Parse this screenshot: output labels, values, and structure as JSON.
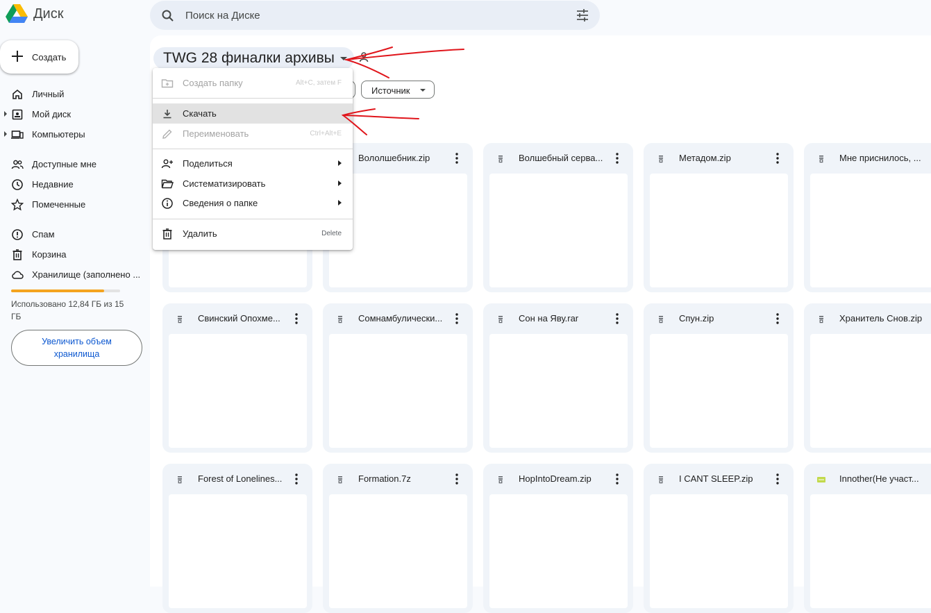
{
  "app": {
    "logo_text": "Диск"
  },
  "search": {
    "placeholder": "Поиск на Диске"
  },
  "sidebar": {
    "create_label": "Создать",
    "items": [
      {
        "label": "Личный",
        "icon": "home-icon"
      },
      {
        "label": "Мой диск",
        "icon": "my-drive-icon"
      },
      {
        "label": "Компьютеры",
        "icon": "computers-icon"
      },
      {
        "label": "Доступные мне",
        "icon": "shared-icon"
      },
      {
        "label": "Недавние",
        "icon": "clock-icon"
      },
      {
        "label": "Помеченные",
        "icon": "star-icon"
      },
      {
        "label": "Спам",
        "icon": "spam-icon"
      },
      {
        "label": "Корзина",
        "icon": "trash-icon"
      },
      {
        "label": "Хранилище (заполнено ...",
        "icon": "cloud-icon"
      }
    ],
    "storage": {
      "used_fraction": 0.856,
      "text": "Использовано 12,84 ГБ из 15 ГБ"
    },
    "upgrade_label": "Увеличить объем хранилища"
  },
  "main": {
    "folder_title": "TWG 28 финалки архивы",
    "filters": {
      "source": "Источник"
    }
  },
  "menu": {
    "items": [
      {
        "label": "Создать папку",
        "shortcut": "Alt+C, затем F",
        "disabled": true
      },
      {
        "label": "Скачать",
        "shortcut": "",
        "highlighted": true
      },
      {
        "label": "Переименовать",
        "shortcut": "Ctrl+Alt+E",
        "disabled": true
      },
      {
        "label": "Поделиться",
        "submenu": true
      },
      {
        "label": "Систематизировать",
        "submenu": true
      },
      {
        "label": "Сведения о папке",
        "submenu": true
      },
      {
        "label": "Удалить",
        "shortcut": "Delete"
      }
    ]
  },
  "files": [
    {
      "name": "Вололшебник.zip",
      "type": "archive"
    },
    {
      "name": "Волшебный серва...",
      "type": "archive"
    },
    {
      "name": "Метадом.zip",
      "type": "archive"
    },
    {
      "name": "Мне приснилось, ...",
      "type": "archive"
    },
    {
      "name": "Свинский Опохме...",
      "type": "archive"
    },
    {
      "name": "Сомнамбулически...",
      "type": "archive"
    },
    {
      "name": "Сон на Яву.rar",
      "type": "archive"
    },
    {
      "name": "Спун.zip",
      "type": "archive"
    },
    {
      "name": "Хранитель Снов.zip",
      "type": "archive"
    },
    {
      "name": "Forest of Lonelines...",
      "type": "archive"
    },
    {
      "name": "Formation.7z",
      "type": "archive"
    },
    {
      "name": "HopIntoDream.zip",
      "type": "archive"
    },
    {
      "name": "I CANT SLEEP.zip",
      "type": "archive"
    },
    {
      "name": "Innother(Не участ...",
      "type": "sheet"
    }
  ],
  "colors": {
    "accent": "#0b57d0",
    "storage": "#f4a41f",
    "annotation": "#e0151b",
    "sheet_icon": "#c2d94b"
  }
}
